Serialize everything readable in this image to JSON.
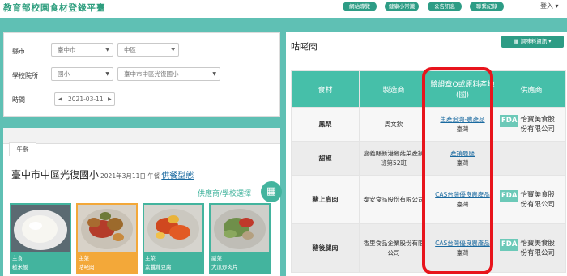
{
  "site": {
    "title": "教育部校園食材登錄平臺"
  },
  "nav": {
    "buttons": [
      "網站導覽",
      "健康小常識",
      "公告訊息",
      "聯繫紀錄"
    ],
    "login_label": "登入"
  },
  "filters": {
    "county_label": "縣市",
    "county_value": "臺中市",
    "district_value": "中區",
    "school_label": "學校院所",
    "school_level_value": "國小",
    "school_value": "臺中市中區光復國小",
    "date_label": "時間",
    "date_prev": "◀",
    "date_value": "2021-03-11",
    "date_next": "▶"
  },
  "lunch": {
    "tab_label": "午餐",
    "school_name": "臺中市中區光復國小",
    "date_text": "2021年3月11日 午餐",
    "supplier_type_link": "供餐型態",
    "supplier_select_label": "供應商/學校選擇",
    "dishes": [
      {
        "category": "主食",
        "name": "糙米飯"
      },
      {
        "category": "主菜",
        "name": "咕咾肉"
      },
      {
        "category": "主菜",
        "name": "素蠶茸豆腐"
      },
      {
        "category": "副菜",
        "name": "大瓜炒肉片"
      }
    ]
  },
  "detail": {
    "title": "咕咾肉",
    "nutrition_button": "調味料資訊",
    "columns": [
      "食材",
      "製造商",
      "驗證章Q或原料產地(國)",
      "供應商"
    ],
    "rows": [
      {
        "food": "鳳梨",
        "maker": "周文欽",
        "cert": "生產追溯-農產品",
        "origin": "臺灣",
        "supplier": "怡寶美食股份有限公司"
      },
      {
        "food": "甜椒",
        "maker": "嘉義縣新港鄉菇菜產銷班第52班",
        "cert": "產銷履歷",
        "origin": "臺灣",
        "supplier": ""
      },
      {
        "food": "豬上肩肉",
        "maker": "泰安食品股份有限公司",
        "cert": "CAS台灣優良農產品",
        "origin": "臺灣",
        "supplier": "怡寶美食股份有限公司"
      },
      {
        "food": "豬後腿肉",
        "maker": "香里食品企業股份有限公司",
        "cert": "CAS台灣優良農產品",
        "origin": "臺灣",
        "supplier": "怡寶美食股份有限公司"
      }
    ],
    "fda_badge": "FDA"
  },
  "colors": {
    "teal": "#46bfa9",
    "accent": "#2d9c85",
    "highlight": "#e8141c",
    "active_dish": "#f3a839"
  }
}
